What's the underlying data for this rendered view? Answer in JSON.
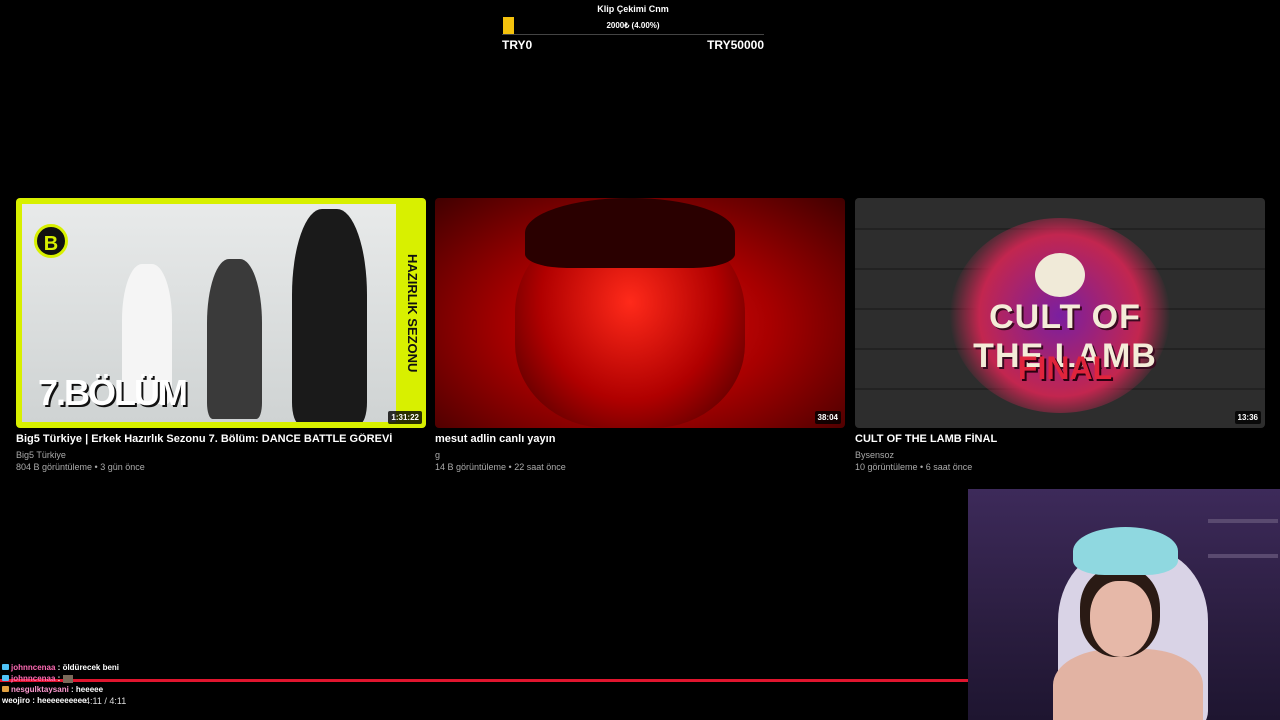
{
  "goal": {
    "title": "Klip Çekimi Cnm",
    "value_text": "2000₺ (4.00%)",
    "progress": 0.04,
    "min_label": "TRY0",
    "max_label": "TRY50000",
    "fill_color": "#f4c20d"
  },
  "videos": [
    {
      "title": "Big5 Türkiye | Erkek Hazırlık Sezonu 7. Bölüm: DANCE BATTLE GÖREVİ",
      "channel": "Big5 Türkiye",
      "meta": "804 B görüntüleme • 3 gün önce",
      "duration": "1:31:22",
      "thumb_text": "7.BÖLÜM",
      "thumb_side": "HAZIRLIK SEZONU",
      "thumb_logo": "B"
    },
    {
      "title": "mesut adlin canlı yayın",
      "channel": "g",
      "meta": "14 B görüntüleme • 22 saat önce",
      "duration": "38:04"
    },
    {
      "title": "CULT OF THE LAMB FİNAL",
      "channel": "Bysensoz",
      "meta": "10 görüntüleme • 6 saat önce",
      "duration": "13:36",
      "thumb_text": "CULT OF THE LAMB",
      "thumb_sub": "FINAL"
    }
  ],
  "player": {
    "time": "4:11 / 4:11",
    "progress": 1.0,
    "progress_color": "#e0152e"
  },
  "chat": [
    {
      "user": "johnncenaa",
      "message": "öldürecek beni",
      "user_color": "#ff6bb5",
      "badge": "#4fc3f7"
    },
    {
      "user": "johnncenaa",
      "message": "",
      "emote": true,
      "user_color": "#ff6bb5",
      "badge": "#4fc3f7"
    },
    {
      "user": "nesgulktaysani",
      "message": "heeeee",
      "user_color": "#ff9ad0",
      "badge": "#e0a040"
    },
    {
      "user": "weojiro",
      "message": "heeeeeeeeee",
      "user_color": "#ffffff",
      "badge": ""
    }
  ]
}
